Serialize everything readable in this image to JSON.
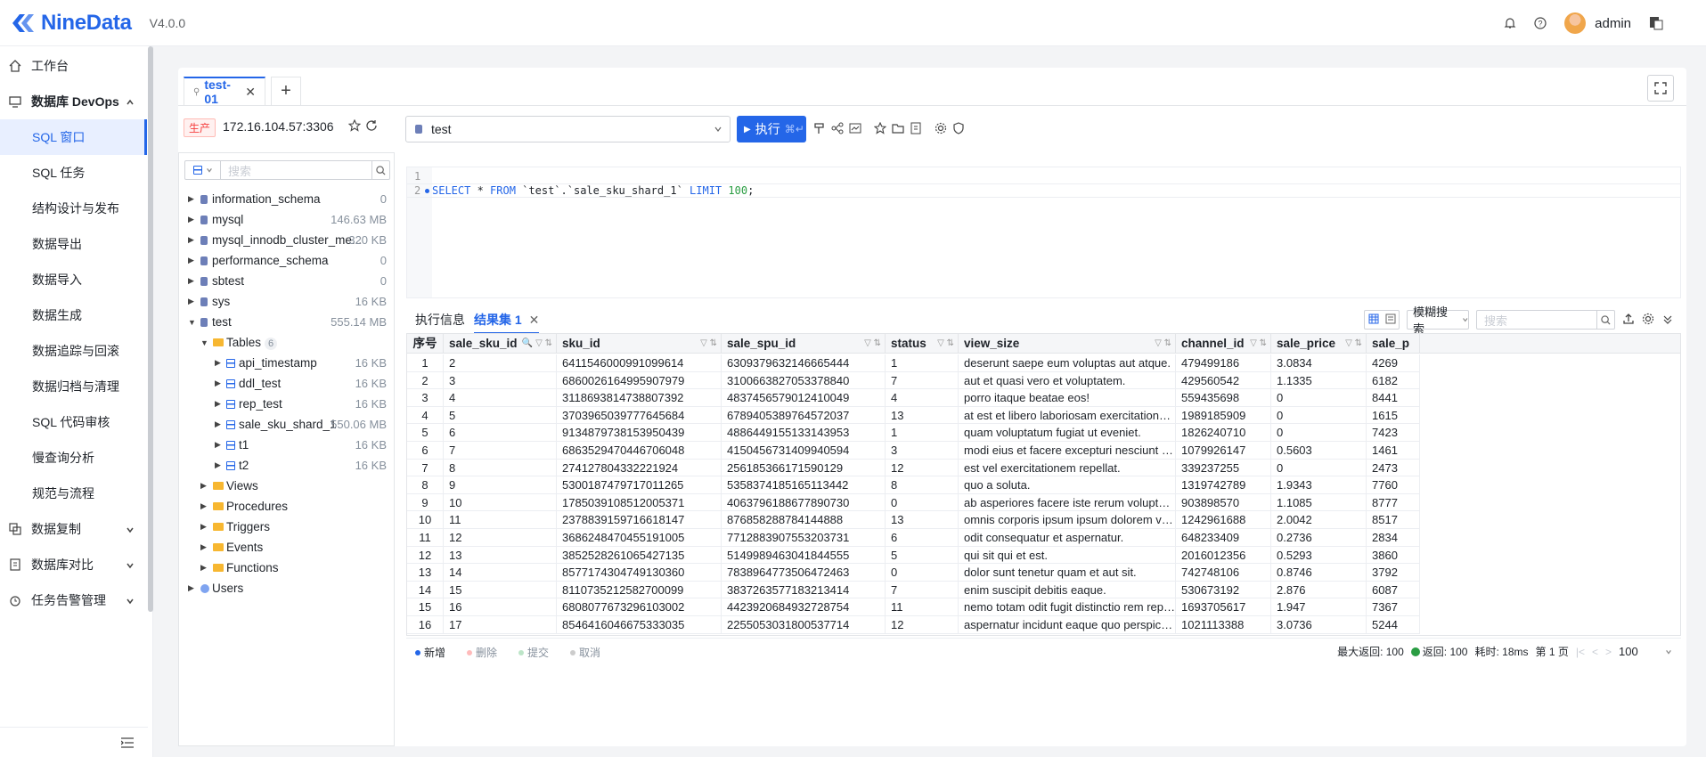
{
  "app": {
    "name": "NineData",
    "version": "V4.0.0",
    "user": "admin"
  },
  "sidebar": {
    "items": [
      {
        "label": "工作台",
        "icon": "home-icon"
      },
      {
        "label": "数据库 DevOps",
        "icon": "monitor-icon"
      },
      {
        "label": "SQL 窗口"
      },
      {
        "label": "SQL 任务"
      },
      {
        "label": "结构设计与发布"
      },
      {
        "label": "数据导出"
      },
      {
        "label": "数据导入"
      },
      {
        "label": "数据生成"
      },
      {
        "label": "数据追踪与回滚"
      },
      {
        "label": "数据归档与清理"
      },
      {
        "label": "SQL 代码审核"
      },
      {
        "label": "慢查询分析"
      },
      {
        "label": "规范与流程"
      },
      {
        "label": "数据复制",
        "icon": "replicate-icon"
      },
      {
        "label": "数据库对比",
        "icon": "compare-icon"
      },
      {
        "label": "任务告警管理",
        "icon": "alarm-icon"
      }
    ]
  },
  "tabs": [
    {
      "label": "test-01"
    }
  ],
  "connection": {
    "env": "生产",
    "address": "172.16.104.57:3306"
  },
  "database_select": {
    "value": "test"
  },
  "execute": {
    "label": "执行",
    "shortcut": "⌘↵"
  },
  "tree": {
    "search_placeholder": "搜索",
    "nodes": [
      {
        "name": "information_schema",
        "size": "0"
      },
      {
        "name": "mysql",
        "size": "146.63 MB"
      },
      {
        "name": "mysql_innodb_cluster_me...",
        "size": "320 KB"
      },
      {
        "name": "performance_schema",
        "size": "0"
      },
      {
        "name": "sbtest",
        "size": "0"
      },
      {
        "name": "sys",
        "size": "16 KB"
      },
      {
        "name": "test",
        "size": "555.14 MB"
      }
    ],
    "tables_label": "Tables",
    "tables_count": "6",
    "tables": [
      {
        "name": "api_timestamp",
        "size": "16 KB"
      },
      {
        "name": "ddl_test",
        "size": "16 KB"
      },
      {
        "name": "rep_test",
        "size": "16 KB"
      },
      {
        "name": "sale_sku_shard_1",
        "size": "550.06 MB"
      },
      {
        "name": "t1",
        "size": "16 KB"
      },
      {
        "name": "t2",
        "size": "16 KB"
      }
    ],
    "folders": [
      "Views",
      "Procedures",
      "Triggers",
      "Events",
      "Functions"
    ],
    "users_label": "Users"
  },
  "editor": {
    "lines": [
      "",
      "SELECT * FROM `test`.`sale_sku_shard_1` LIMIT 100;"
    ]
  },
  "results": {
    "tab_info": "执行信息",
    "tab_result": "结果集 1",
    "fuzzy_label": "模糊搜索",
    "search_placeholder": "搜索",
    "columns": [
      "序号",
      "sale_sku_id",
      "sku_id",
      "sale_spu_id",
      "status",
      "view_size",
      "channel_id",
      "sale_price",
      "sale_p"
    ],
    "rows": [
      [
        "1",
        "2",
        "6411546000991099614",
        "6309379632146665444",
        "1",
        "deserunt saepe eum voluptas aut atque.",
        "479499186",
        "3.0834",
        "4269"
      ],
      [
        "2",
        "3",
        "6860026164995907979",
        "3100663827053378840",
        "7",
        "aut et quasi vero et voluptatem.",
        "429560542",
        "1.1335",
        "6182"
      ],
      [
        "3",
        "4",
        "3118693814738807392",
        "4837456579012410049",
        "4",
        "porro itaque beatae eos!",
        "559435698",
        "0",
        "8441"
      ],
      [
        "4",
        "5",
        "3703965039777645684",
        "6789405389764572037",
        "13",
        "at est et libero laboriosam exercitationem ...",
        "1989185909",
        "0",
        "1615"
      ],
      [
        "5",
        "6",
        "9134879738153950439",
        "4886449155133143953",
        "1",
        "quam voluptatum fugiat ut eveniet.",
        "1826240710",
        "0",
        "7423"
      ],
      [
        "6",
        "7",
        "6863529470446706048",
        "4150456731409940594",
        "3",
        "modi eius et facere excepturi nesciunt sae...",
        "1079926147",
        "0.5603",
        "1461"
      ],
      [
        "7",
        "8",
        "274127804332221924",
        "256185366171590129",
        "12",
        "est vel exercitationem repellat.",
        "339237255",
        "0",
        "2473"
      ],
      [
        "8",
        "9",
        "5300187479717011265",
        "5358374185165113442",
        "8",
        "quo a soluta.",
        "1319742789",
        "1.9343",
        "7760"
      ],
      [
        "9",
        "10",
        "1785039108512005371",
        "4063796188677890730",
        "0",
        "ab asperiores facere iste rerum voluptate...",
        "903898570",
        "1.1085",
        "8777"
      ],
      [
        "10",
        "11",
        "2378839159716618147",
        "876858288784144888",
        "13",
        "omnis corporis ipsum ipsum dolorem velit...",
        "1242961688",
        "2.0042",
        "8517"
      ],
      [
        "11",
        "12",
        "3686248470455191005",
        "7712883907553203731",
        "6",
        "odit consequatur et aspernatur.",
        "648233409",
        "0.2736",
        "2834"
      ],
      [
        "12",
        "13",
        "3852528261065427135",
        "5149989463041844555",
        "5",
        "qui sit qui et est.",
        "2016012356",
        "0.5293",
        "3860"
      ],
      [
        "13",
        "14",
        "8577174304749130360",
        "7838964773506472463",
        "0",
        "dolor sunt tenetur quam et aut sit.",
        "742748106",
        "0.8746",
        "3792"
      ],
      [
        "14",
        "15",
        "8110735212582700099",
        "3837263577183213414",
        "7",
        "enim suscipit debitis eaque.",
        "530673192",
        "2.876",
        "6087"
      ],
      [
        "15",
        "16",
        "6808077673296103002",
        "4423920684932728754",
        "11",
        "nemo totam odit fugit distinctio rem repell...",
        "1693705617",
        "1.947",
        "7367"
      ],
      [
        "16",
        "17",
        "8546416046675333035",
        "2255053031800537714",
        "12",
        "aspernatur incidunt eaque quo perspiciatis...",
        "1021113388",
        "3.0736",
        "5244"
      ]
    ]
  },
  "footer": {
    "add": "新增",
    "delete": "删除",
    "submit": "提交",
    "cancel": "取消",
    "max_return_label": "最大返回: 100",
    "returned": "返回: 100",
    "time": "耗时: 18ms",
    "page": "第 1 页",
    "page_size": "100"
  },
  "colors": {
    "accent": "#2466e8",
    "danger": "#f53f3f",
    "folder": "#f7b731"
  }
}
